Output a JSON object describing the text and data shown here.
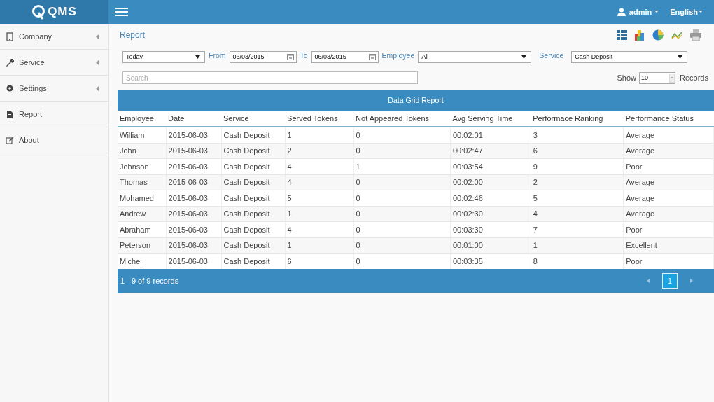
{
  "header": {
    "logo": "QMS",
    "user": "admin",
    "language": "English"
  },
  "sidebar": {
    "items": [
      {
        "label": "Company",
        "kind": "tablet",
        "has_submenu": true
      },
      {
        "label": "Service",
        "kind": "wrench",
        "has_submenu": true
      },
      {
        "label": "Settings",
        "kind": "gear",
        "has_submenu": true
      },
      {
        "label": "Report",
        "kind": "file",
        "has_submenu": false
      },
      {
        "label": "About",
        "kind": "edit",
        "has_submenu": false
      }
    ]
  },
  "page": {
    "title": "Report"
  },
  "filters": {
    "period": "Today",
    "from_label": "From",
    "from": "06/03/2015",
    "to_label": "To",
    "to": "06/03/2015",
    "employee_label": "Employee",
    "employee": "All",
    "service_label": "Service",
    "service": "Cash Deposit"
  },
  "search": {
    "placeholder": "Search"
  },
  "page_size": {
    "label": "Show",
    "value": "10",
    "suffix": "Records"
  },
  "table": {
    "title": "Data Grid Report",
    "columns": [
      "Employee",
      "Date",
      "Service",
      "Served Tokens",
      "Not Appeared Tokens",
      "Avg Serving Time",
      "Performace Ranking",
      "Performance Status"
    ],
    "rows": [
      [
        "William",
        "2015-06-03",
        "Cash Deposit",
        "1",
        "0",
        "00:02:01",
        "3",
        "Average"
      ],
      [
        "John",
        "2015-06-03",
        "Cash Deposit",
        "2",
        "0",
        "00:02:47",
        "6",
        "Average"
      ],
      [
        "Johnson",
        "2015-06-03",
        "Cash Deposit",
        "4",
        "1",
        "00:03:54",
        "9",
        "Poor"
      ],
      [
        "Thomas",
        "2015-06-03",
        "Cash Deposit",
        "4",
        "0",
        "00:02:00",
        "2",
        "Average"
      ],
      [
        "Mohamed",
        "2015-06-03",
        "Cash Deposit",
        "5",
        "0",
        "00:02:46",
        "5",
        "Average"
      ],
      [
        "Andrew",
        "2015-06-03",
        "Cash Deposit",
        "1",
        "0",
        "00:02:30",
        "4",
        "Average"
      ],
      [
        "Abraham",
        "2015-06-03",
        "Cash Deposit",
        "4",
        "0",
        "00:03:30",
        "7",
        "Poor"
      ],
      [
        "Peterson",
        "2015-06-03",
        "Cash Deposit",
        "1",
        "0",
        "00:01:00",
        "1",
        "Excellent"
      ],
      [
        "Michel",
        "2015-06-03",
        "Cash Deposit",
        "6",
        "0",
        "00:03:35",
        "8",
        "Poor"
      ]
    ]
  },
  "footer": {
    "summary": "1 - 9 of 9 records",
    "pages": [
      {
        "label": "1",
        "selected": true
      }
    ]
  }
}
